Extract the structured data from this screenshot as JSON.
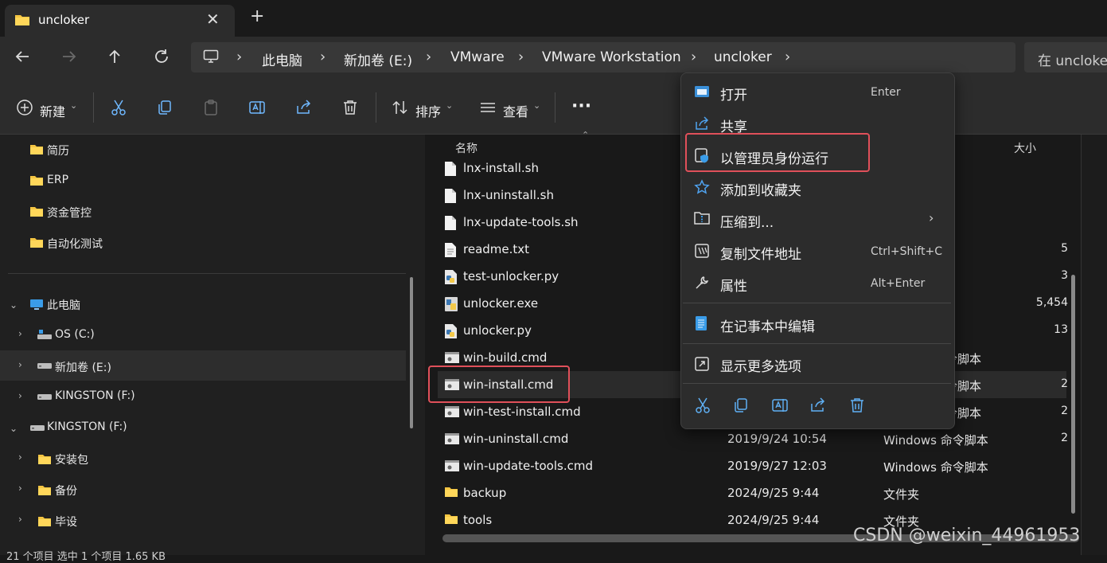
{
  "tab": {
    "title": "uncloker",
    "close": "✕",
    "new": "+"
  },
  "breadcrumb": [
    "此电脑",
    "新加卷 (E:)",
    "VMware",
    "VMware Workstation",
    "uncloker"
  ],
  "search": {
    "placeholder": "在 uncloke"
  },
  "toolbar": {
    "new_label": "新建",
    "sort_label": "排序",
    "view_label": "查看",
    "more": "···"
  },
  "sidebar": {
    "quick": [
      "简历",
      "ERP",
      "资金管控",
      "自动化测试"
    ],
    "this_pc": "此电脑",
    "drives": [
      "OS (C:)",
      "新加卷 (E:)",
      "KINGSTON (F:)"
    ],
    "kingston": "KINGSTON (F:)",
    "kingston_children": [
      "安装包",
      "备份",
      "毕设"
    ]
  },
  "columns": {
    "name": "名称",
    "size": "大小"
  },
  "files": [
    {
      "name": "lnx-install.sh",
      "date": "",
      "type": "",
      "size": ""
    },
    {
      "name": "lnx-uninstall.sh",
      "date": "",
      "type": "",
      "size": ""
    },
    {
      "name": "lnx-update-tools.sh",
      "date": "",
      "type": "",
      "size": ""
    },
    {
      "name": "readme.txt",
      "date": "",
      "type": "",
      "size": "5"
    },
    {
      "name": "test-unlocker.py",
      "date": "",
      "type": "",
      "size": "3"
    },
    {
      "name": "unlocker.exe",
      "date": "",
      "type": "",
      "size": "5,454"
    },
    {
      "name": "unlocker.py",
      "date": "",
      "type": "",
      "size": "13"
    },
    {
      "name": "win-build.cmd",
      "date": "",
      "type": "令脚本",
      "size": ""
    },
    {
      "name": "win-install.cmd",
      "date": "",
      "type": "令脚本",
      "size": "2"
    },
    {
      "name": "win-test-install.cmd",
      "date": "",
      "type": "令脚本",
      "size": "2"
    },
    {
      "name": "win-uninstall.cmd",
      "date": "2019/9/24 10:54",
      "type": "Windows 命令脚本",
      "size": "2"
    },
    {
      "name": "win-update-tools.cmd",
      "date": "2019/9/27 12:03",
      "type": "Windows 命令脚本",
      "size": ""
    },
    {
      "name": "backup",
      "date": "2024/9/25 9:44",
      "type": "文件夹",
      "size": ""
    },
    {
      "name": "tools",
      "date": "2024/9/25 9:44",
      "type": "文件夹",
      "size": ""
    }
  ],
  "menu": {
    "open": "打开",
    "open_key": "Enter",
    "share": "共享",
    "run_admin": "以管理员身份运行",
    "favorite": "添加到收藏夹",
    "compress": "压缩到...",
    "copy_path": "复制文件地址",
    "copy_path_key": "Ctrl+Shift+C",
    "properties": "属性",
    "properties_key": "Alt+Enter",
    "notepad": "在记事本中编辑",
    "more": "显示更多选项"
  },
  "watermark": "CSDN @weixin_44961953",
  "status": "21 个项目  选中 1 个项目 1.65 KB"
}
